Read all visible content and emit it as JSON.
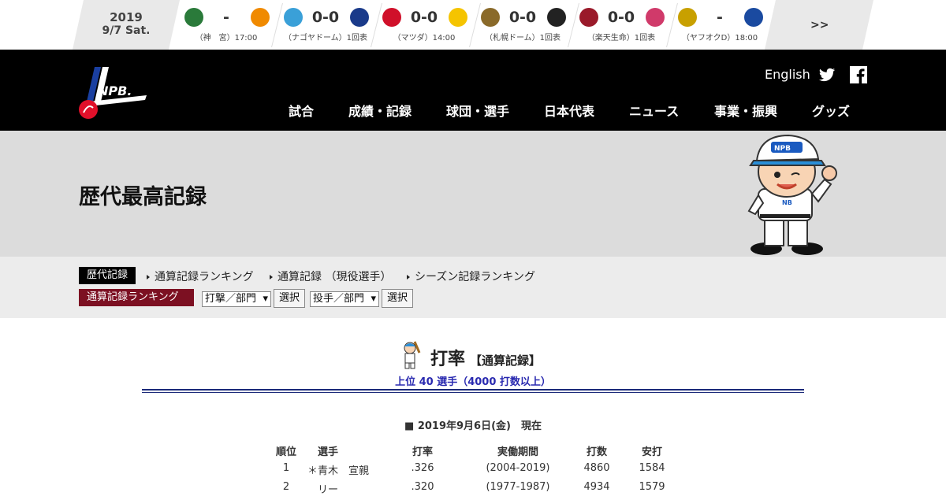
{
  "scorebar": {
    "date_year": "2019",
    "date_day": "9/7 Sat.",
    "more_label": ">>",
    "games": [
      {
        "score": "-",
        "info": "（神　宮）17:00",
        "home_color": "#2a7a3a",
        "away_color": "#f08a00"
      },
      {
        "score": "0-0",
        "info": "（ナゴヤドーム）1回表",
        "home_color": "#3aa0d8",
        "away_color": "#1a3a8a"
      },
      {
        "score": "0-0",
        "info": "（マツダ）14:00",
        "home_color": "#d0102a",
        "away_color": "#f5c400"
      },
      {
        "score": "0-0",
        "info": "（札幌ドーム）1回表",
        "home_color": "#8a6a2a",
        "away_color": "#222222"
      },
      {
        "score": "0-0",
        "info": "（楽天生命）1回表",
        "home_color": "#9a1a2a",
        "away_color": "#d03a6a"
      },
      {
        "score": "-",
        "info": "（ヤフオクD）18:00",
        "home_color": "#c8a000",
        "away_color": "#1a4aa0"
      }
    ]
  },
  "header": {
    "english": "English",
    "nav": [
      "試合",
      "成績・記録",
      "球団・選手",
      "日本代表",
      "ニュース",
      "事業・振興",
      "グッズ"
    ]
  },
  "banner": {
    "title": "歴代最高記録"
  },
  "subnav": {
    "tag_records": "歴代記録",
    "links": [
      "通算記録ランキング",
      "通算記録 （現役選手）",
      "シーズン記録ランキング"
    ],
    "tag_ranking": "通算記録ランキング",
    "batting_select": "打撃／部門",
    "pitching_select": "投手／部門",
    "select_button": "選択"
  },
  "record": {
    "title": "打率",
    "title_suffix": "【通算記録】",
    "subtitle": "上位 40 選手（4000 打数以上）",
    "as_of": "■ 2019年9月6日(金)　現在",
    "columns": [
      "順位",
      "選手",
      "打率",
      "実働期間",
      "打数",
      "安打"
    ],
    "rows": [
      {
        "rank": "1",
        "player": "＊青木　宣親",
        "avg": ".326",
        "period": "(2004-2019)",
        "ab": "4860",
        "hits": "1584"
      },
      {
        "rank": "2",
        "player": "リー",
        "avg": ".320",
        "period": "(1977-1987)",
        "ab": "4934",
        "hits": "1579"
      }
    ]
  }
}
